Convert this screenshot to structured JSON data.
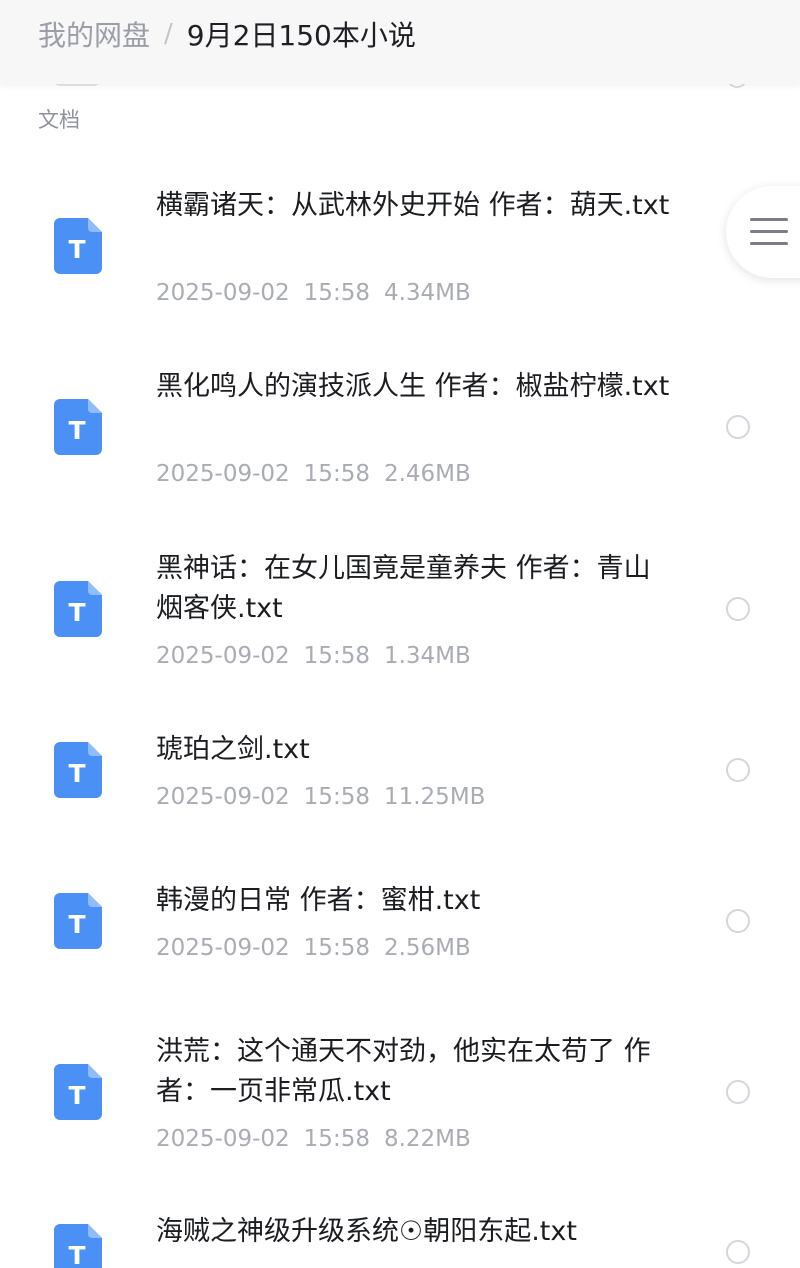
{
  "header": {
    "root": "我的网盘",
    "separator": "/",
    "current": "9月2日150本小说"
  },
  "section_label": "文档",
  "colors": {
    "accent": "#4a90f5",
    "text_primary": "#1b1d21",
    "text_secondary": "#a9acb3"
  },
  "files": [
    {
      "name": "横霸诸天：从武林外史开始 作者：葫天.txt",
      "date": "2025-09-02",
      "time": "15:58",
      "size": "4.34MB",
      "icon": "txt-file-icon",
      "icon_letter": "T"
    },
    {
      "name": "黑化鸣人的演技派人生 作者：椒盐柠檬.txt",
      "date": "2025-09-02",
      "time": "15:58",
      "size": "2.46MB",
      "icon": "txt-file-icon",
      "icon_letter": "T"
    },
    {
      "name": "黑神话：在女儿国竟是童养夫 作者：青山烟客侠.txt",
      "date": "2025-09-02",
      "time": "15:58",
      "size": "1.34MB",
      "icon": "txt-file-icon",
      "icon_letter": "T"
    },
    {
      "name": "琥珀之剑.txt",
      "date": "2025-09-02",
      "time": "15:58",
      "size": "11.25MB",
      "icon": "txt-file-icon",
      "icon_letter": "T"
    },
    {
      "name": "韩漫的日常 作者：蜜柑.txt",
      "date": "2025-09-02",
      "time": "15:58",
      "size": "2.56MB",
      "icon": "txt-file-icon",
      "icon_letter": "T"
    },
    {
      "name": "洪荒：这个通天不对劲，他实在太苟了 作者：一页非常瓜.txt",
      "date": "2025-09-02",
      "time": "15:58",
      "size": "8.22MB",
      "icon": "txt-file-icon",
      "icon_letter": "T"
    },
    {
      "name": "海贼之神级升级系统☉朝阳东起.txt",
      "date": "",
      "time": "",
      "size": "",
      "icon": "txt-file-icon",
      "icon_letter": "T"
    }
  ],
  "menu_button": {
    "icon": "menu-icon"
  }
}
